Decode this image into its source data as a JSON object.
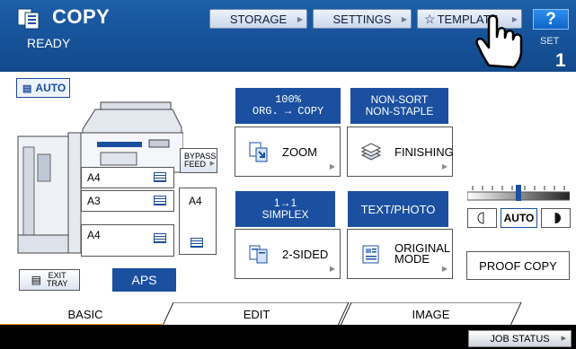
{
  "header": {
    "app_name": "COPY",
    "status": "READY",
    "storage_label": "STORAGE",
    "settings_label": "SETTINGS",
    "template_label": "TEMPLATE",
    "help_label": "?",
    "set_label": "SET",
    "set_value": "1"
  },
  "paper": {
    "auto_label": "AUTO",
    "bypass_label_1": "BYPASS",
    "bypass_label_2": "FEED",
    "trays": [
      {
        "size": "A4"
      },
      {
        "size": "A3"
      },
      {
        "size": "A4"
      }
    ],
    "side_tray": "A4",
    "exit_tray_1": "EXIT",
    "exit_tray_2": "TRAY",
    "aps_label": "APS"
  },
  "functions": {
    "zoom_status_1": "100%",
    "zoom_status_2": "ORG. → COPY",
    "zoom_label": "ZOOM",
    "finishing_status_1": "NON-SORT",
    "finishing_status_2": "NON-STAPLE",
    "finishing_label": "FINISHING",
    "sided_status_1": "1→1",
    "sided_status_2": "SIMPLEX",
    "sided_label": "2-SIDED",
    "original_status": "TEXT/PHOTO",
    "original_label_1": "ORIGINAL",
    "original_label_2": "MODE"
  },
  "density": {
    "auto_label": "AUTO",
    "level": 0.5
  },
  "proof_copy_label": "PROOF COPY",
  "tabs": [
    {
      "label": "BASIC"
    },
    {
      "label": "EDIT"
    },
    {
      "label": "IMAGE"
    }
  ],
  "job_status_label": "JOB STATUS",
  "colors": {
    "brand_blue": "#1b4fa0",
    "header_blue": "#17539a",
    "tab_accent": "#f5a623"
  }
}
